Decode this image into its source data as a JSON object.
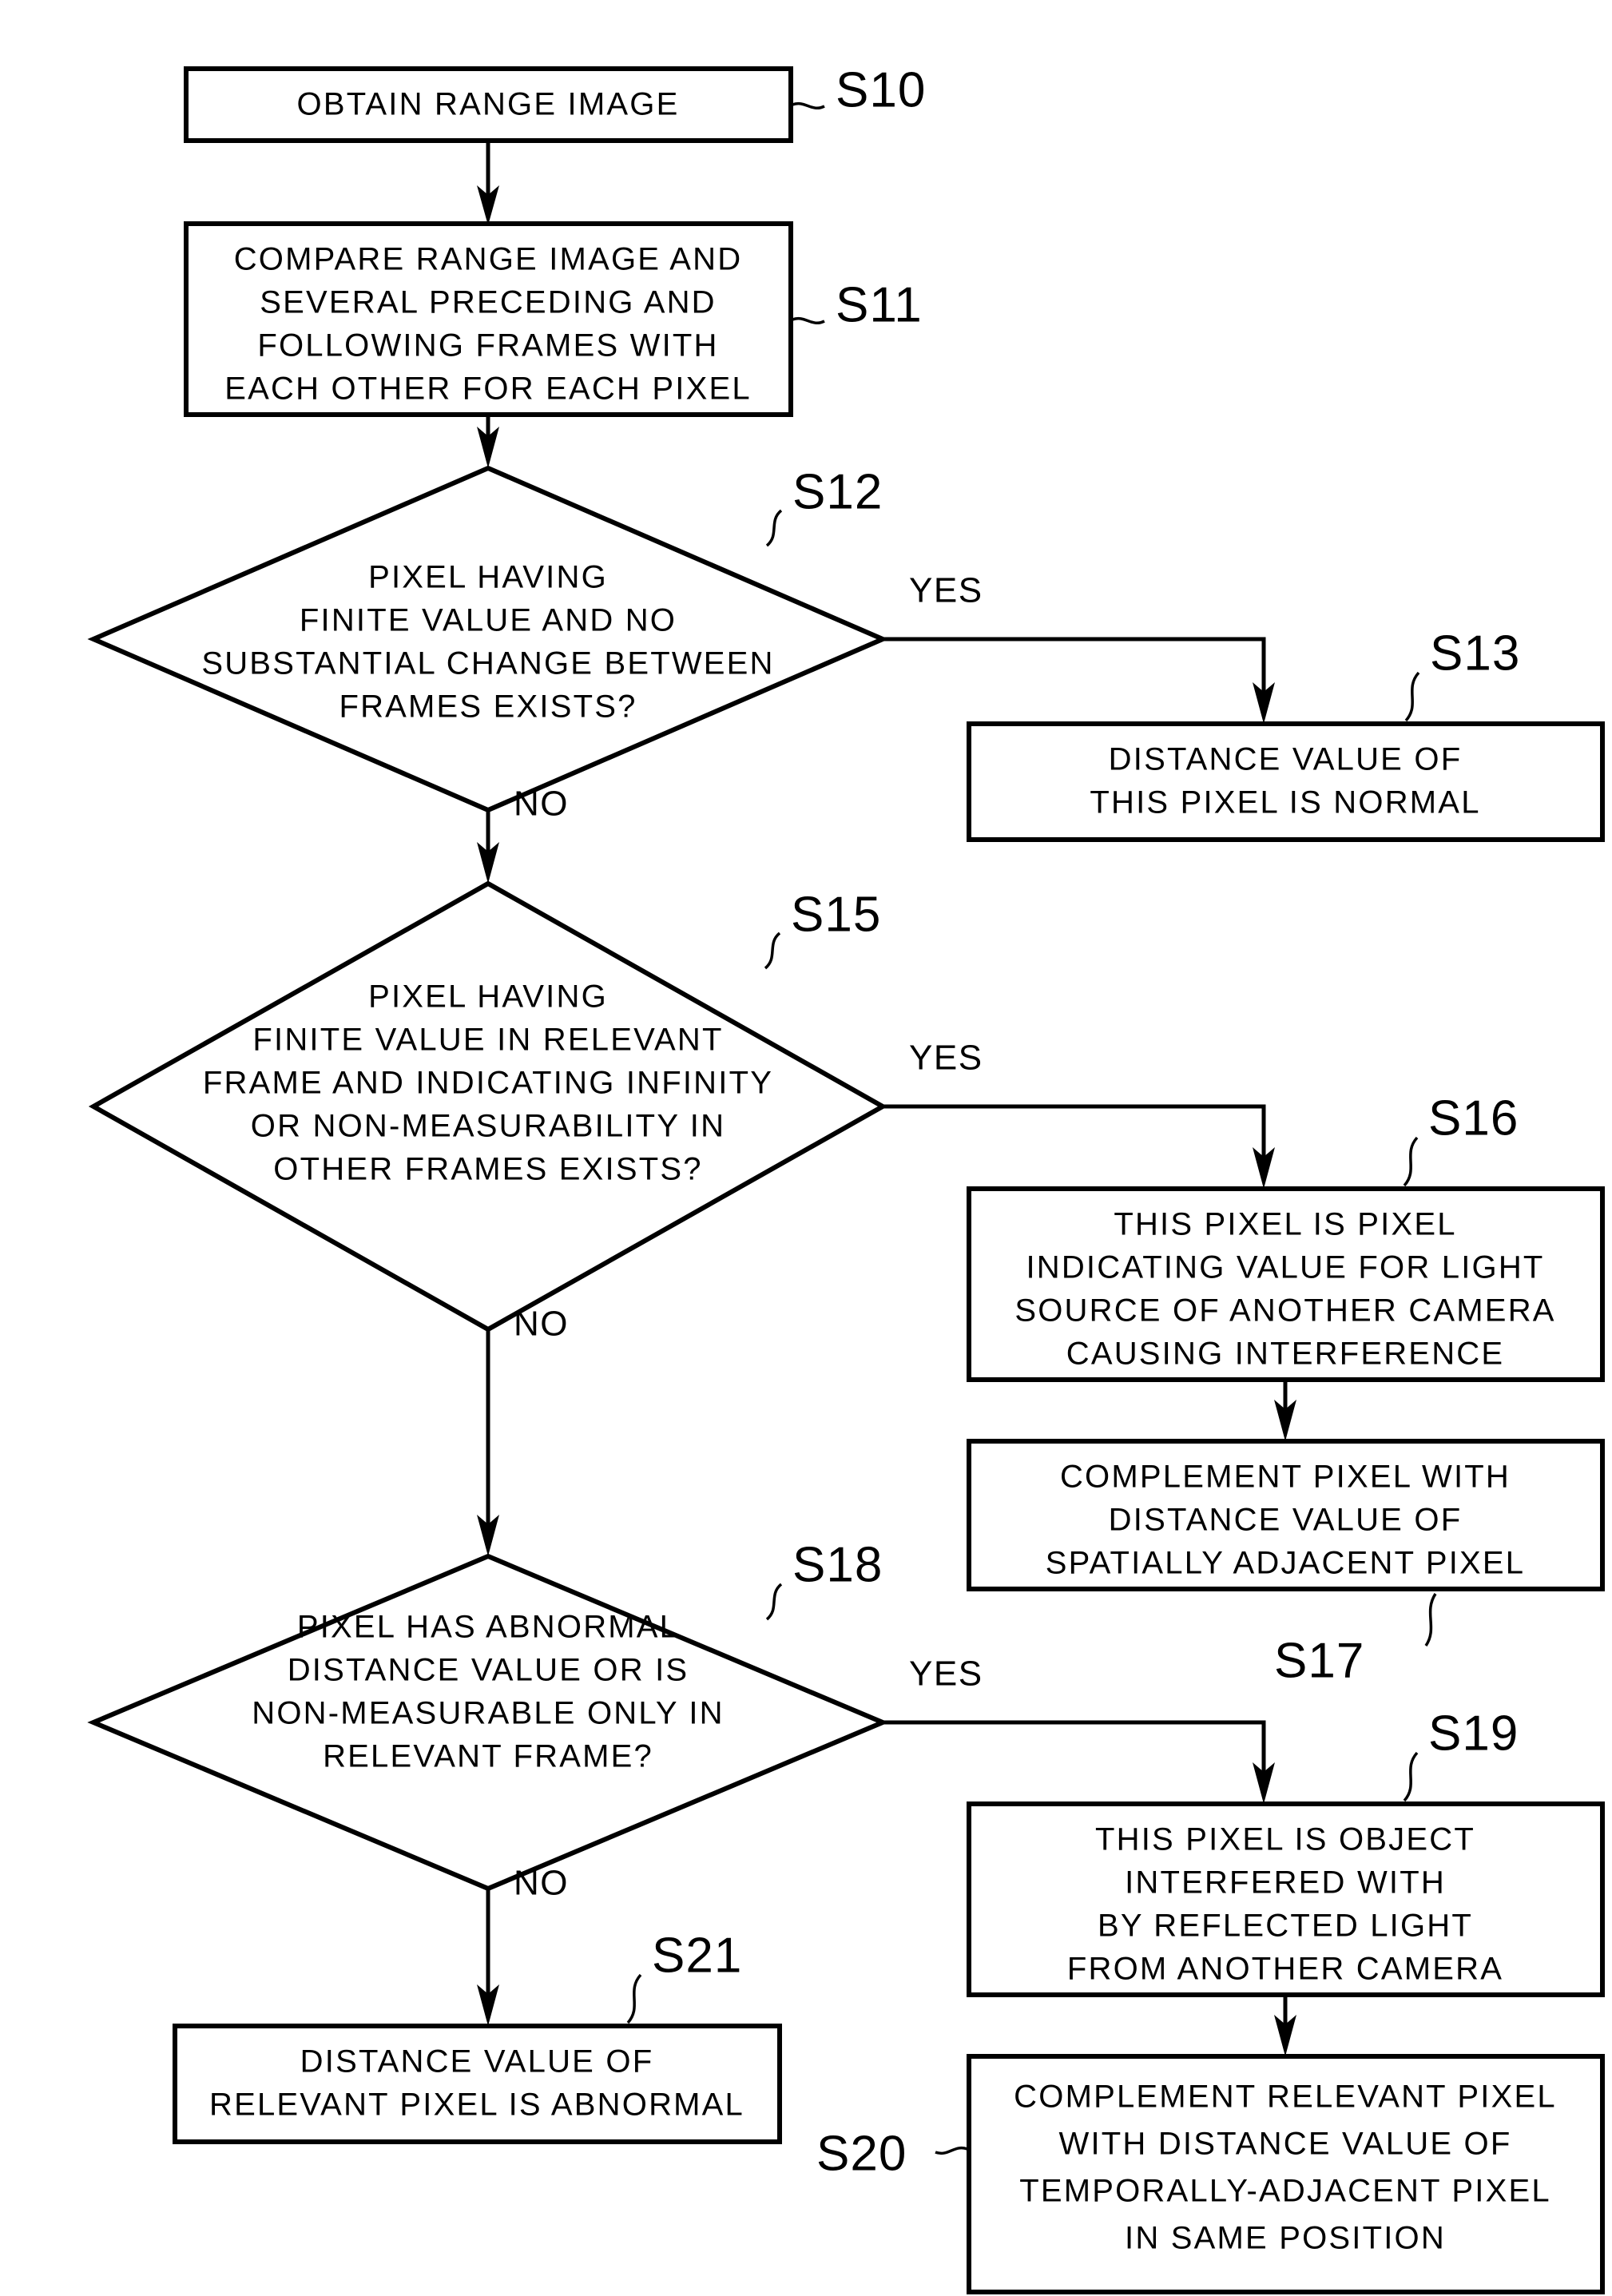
{
  "diagram": {
    "type": "flowchart",
    "title": "Range image pixel abnormality determination and complement flow",
    "orientation": "top-to-bottom",
    "branch_labels": {
      "yes": "YES",
      "no": "NO"
    },
    "nodes": [
      {
        "id": "S10",
        "shape": "process",
        "step_label": "S10",
        "lines": [
          "OBTAIN RANGE IMAGE"
        ]
      },
      {
        "id": "S11",
        "shape": "process",
        "step_label": "S11",
        "lines": [
          "COMPARE RANGE IMAGE AND",
          "SEVERAL PRECEDING AND",
          "FOLLOWING FRAMES WITH",
          "EACH OTHER FOR EACH PIXEL"
        ]
      },
      {
        "id": "S12",
        "shape": "decision",
        "step_label": "S12",
        "lines": [
          "PIXEL HAVING",
          "FINITE VALUE AND NO",
          "SUBSTANTIAL CHANGE BETWEEN",
          "FRAMES EXISTS?"
        ]
      },
      {
        "id": "S13",
        "shape": "process",
        "step_label": "S13",
        "lines": [
          "DISTANCE VALUE OF",
          "THIS PIXEL IS NORMAL"
        ]
      },
      {
        "id": "S15",
        "shape": "decision",
        "step_label": "S15",
        "lines": [
          "PIXEL HAVING",
          "FINITE VALUE IN RELEVANT",
          "FRAME AND INDICATING INFINITY",
          "OR NON-MEASURABILITY IN",
          "OTHER FRAMES EXISTS?"
        ]
      },
      {
        "id": "S16",
        "shape": "process",
        "step_label": "S16",
        "lines": [
          "THIS PIXEL IS PIXEL",
          "INDICATING VALUE FOR LIGHT",
          "SOURCE OF ANOTHER CAMERA",
          "CAUSING INTERFERENCE"
        ]
      },
      {
        "id": "S17",
        "shape": "process",
        "step_label": "S17",
        "lines": [
          "COMPLEMENT PIXEL WITH",
          "DISTANCE VALUE OF",
          "SPATIALLY ADJACENT PIXEL"
        ]
      },
      {
        "id": "S18",
        "shape": "decision",
        "step_label": "S18",
        "lines": [
          "PIXEL HAS ABNORMAL",
          "DISTANCE VALUE OR IS",
          "NON-MEASURABLE ONLY IN",
          "RELEVANT FRAME?"
        ]
      },
      {
        "id": "S19",
        "shape": "process",
        "step_label": "S19",
        "lines": [
          "THIS PIXEL IS OBJECT",
          "INTERFERED WITH",
          "BY REFLECTED LIGHT",
          "FROM ANOTHER CAMERA"
        ]
      },
      {
        "id": "S20",
        "shape": "process",
        "step_label": "S20",
        "lines": [
          "COMPLEMENT RELEVANT PIXEL",
          "WITH DISTANCE VALUE OF",
          "TEMPORALLY-ADJACENT PIXEL",
          "IN SAME POSITION"
        ]
      },
      {
        "id": "S21",
        "shape": "process",
        "step_label": "S21",
        "lines": [
          "DISTANCE VALUE OF",
          "RELEVANT PIXEL IS ABNORMAL"
        ]
      }
    ],
    "edges": [
      {
        "from": "S10",
        "to": "S11",
        "label": ""
      },
      {
        "from": "S11",
        "to": "S12",
        "label": ""
      },
      {
        "from": "S12",
        "to": "S13",
        "label": "YES"
      },
      {
        "from": "S12",
        "to": "S15",
        "label": "NO"
      },
      {
        "from": "S15",
        "to": "S16",
        "label": "YES"
      },
      {
        "from": "S15",
        "to": "S18",
        "label": "NO"
      },
      {
        "from": "S16",
        "to": "S17",
        "label": ""
      },
      {
        "from": "S18",
        "to": "S19",
        "label": "YES"
      },
      {
        "from": "S18",
        "to": "S21",
        "label": "NO"
      },
      {
        "from": "S19",
        "to": "S20",
        "label": ""
      }
    ],
    "colors": {
      "background": "#ffffff",
      "stroke": "#000000",
      "text": "#000000"
    }
  }
}
